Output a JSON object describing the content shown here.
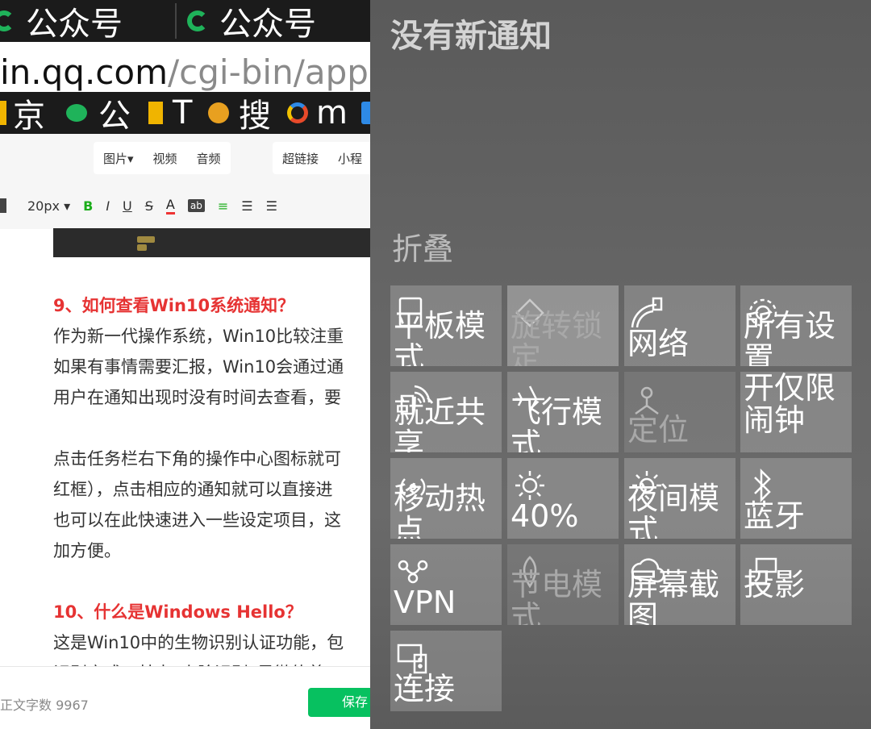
{
  "browser": {
    "tabs": [
      {
        "title": "公众号"
      },
      {
        "title": "公众号"
      }
    ],
    "url": {
      "main": "in.qq.com",
      "rest": "/cgi-bin/appm"
    },
    "bookmarks": [
      "京",
      "公",
      "T",
      "搜",
      "m"
    ]
  },
  "editor": {
    "toolbar_group1": [
      "图片▾",
      "视频",
      "音频"
    ],
    "toolbar_group2": [
      "超链接",
      "小程"
    ],
    "font_size": "20px ▾",
    "format_buttons": {
      "bold": "B",
      "italic": "I",
      "underline": "U",
      "strike": "S",
      "font_color": "A",
      "highlight": "ab"
    },
    "article": {
      "heading9": "9、如何查看Win10系统通知？",
      "para9_lines": [
        "作为新一代操作系统，Win10比较注重",
        "如果有事情需要汇报，Win10会通过通",
        "用户在通知出现时没有时间去查看，要"
      ],
      "para9b_lines": [
        "点击任务栏右下角的操作中心图标就可",
        "红框），点击相应的通知就可以直接进",
        "也可以在此快速进入一些设定项目，这",
        "加方便。"
      ],
      "heading10": "10、什么是Windows Hello？",
      "para10_lines": [
        "这是Win10中的生物识别认证功能，包",
        "识别方式，其中“人脸识别”是微软着"
      ]
    },
    "footer": {
      "word_count": "正文字数  9967",
      "save": "保存"
    }
  },
  "action_center": {
    "no_notifications": "没有新通知",
    "collapse": "折叠",
    "tiles": [
      {
        "label": "平板模式",
        "icon": "tablet-mode-icon",
        "state": "on"
      },
      {
        "label": "旋转锁定",
        "icon": "rotation-lock-icon",
        "state": "off"
      },
      {
        "label": "网络",
        "icon": "network-icon",
        "state": "on"
      },
      {
        "label": "所有设置",
        "icon": "settings-gear-icon",
        "state": "on"
      },
      {
        "label": "就近共享",
        "icon": "nearby-share-icon",
        "state": "on"
      },
      {
        "label": "飞行模式",
        "icon": "airplane-icon",
        "state": "on"
      },
      {
        "label": "定位",
        "icon": "location-icon",
        "state": "off"
      },
      {
        "label": "开仅限闹钟",
        "icon": "focus-assist-icon",
        "state": "on"
      },
      {
        "label": "移动热点",
        "icon": "mobile-hotspot-icon",
        "state": "on"
      },
      {
        "label": "40%",
        "icon": "brightness-icon",
        "state": "on"
      },
      {
        "label": "夜间模式",
        "icon": "night-light-icon",
        "state": "on"
      },
      {
        "label": "蓝牙",
        "icon": "bluetooth-icon",
        "state": "on"
      },
      {
        "label": "VPN",
        "icon": "vpn-icon",
        "state": "on"
      },
      {
        "label": "节电模式",
        "icon": "battery-saver-icon",
        "state": "off"
      },
      {
        "label": "屏幕截图",
        "icon": "screen-snip-icon",
        "state": "on"
      },
      {
        "label": "投影",
        "icon": "project-icon",
        "state": "on"
      },
      {
        "label": "连接",
        "icon": "connect-icon",
        "state": "on"
      }
    ]
  }
}
